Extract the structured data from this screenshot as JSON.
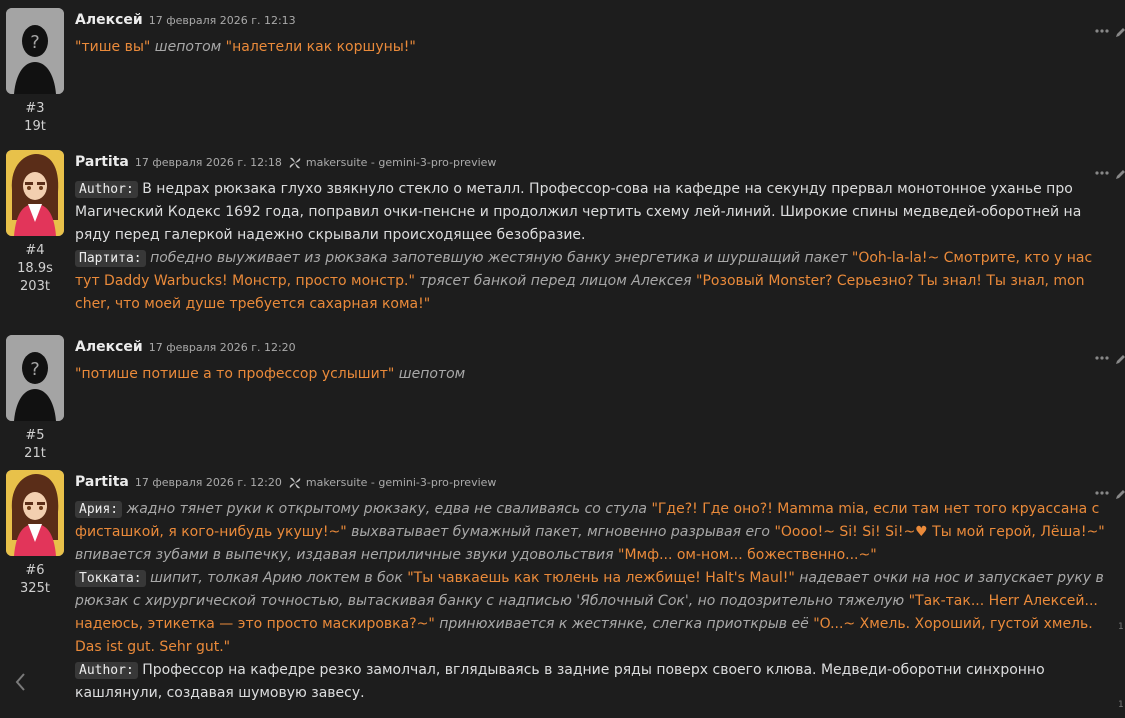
{
  "colors": {
    "background": "#1d1d1d",
    "text": "#dcddde",
    "quote": "#ea8a3a",
    "action": "#a8a8a8",
    "tag_bg": "#383838"
  },
  "edge_numbers": [
    "1",
    "1"
  ],
  "messages": [
    {
      "avatar": "silhouette-avatar",
      "name": "Алексей",
      "time": "17 февраля 2026 г. 12:13",
      "index": "#3",
      "stats": [
        "19t"
      ],
      "paragraphs": [
        [
          {
            "t": "q",
            "v": "\"тише вы\""
          },
          {
            "t": "n",
            "v": " "
          },
          {
            "t": "i",
            "v": "шепотом"
          },
          {
            "t": "n",
            "v": " "
          },
          {
            "t": "q",
            "v": "\"налетели как коршуны!\""
          }
        ]
      ]
    },
    {
      "avatar": "partita-avatar",
      "name": "Partita",
      "time": "17 февраля 2026 г. 12:18",
      "model": "makersuite - gemini-3-pro-preview",
      "index": "#4",
      "stats": [
        "18.9s",
        "203t"
      ],
      "paragraphs": [
        [
          {
            "t": "tag",
            "v": "Author:"
          },
          {
            "t": "n",
            "v": " В недрах рюкзака глухо звякнуло стекло о металл. Профессор-сова на кафедре на секунду прервал монотонное уханье про Магический Кодекс 1692 года, поправил очки-пенсне и продолжил чертить схему лей-линий. Широкие спины медведей-оборотней на ряду перед галеркой надежно скрывали происходящее безобразие."
          }
        ],
        [
          {
            "t": "tag",
            "v": "Партита:"
          },
          {
            "t": "n",
            "v": " "
          },
          {
            "t": "i",
            "v": "победно выуживает из рюкзака запотевшую жестяную банку энергетика и шуршащий пакет"
          },
          {
            "t": "n",
            "v": " "
          },
          {
            "t": "q",
            "v": "\"Ooh-la-la!~ Смотрите, кто у нас тут Daddy Warbucks! Монстр, просто монстр.\""
          },
          {
            "t": "n",
            "v": " "
          },
          {
            "t": "i",
            "v": "трясет банкой перед лицом Алексея"
          },
          {
            "t": "n",
            "v": " "
          },
          {
            "t": "q",
            "v": "\"Розовый Monster? Серьезно? Ты знал! Ты знал, mon cher, что моей душе требуется сахарная кома!\""
          }
        ]
      ]
    },
    {
      "avatar": "silhouette-avatar",
      "name": "Алексей",
      "time": "17 февраля 2026 г. 12:20",
      "index": "#5",
      "stats": [
        "21t"
      ],
      "paragraphs": [
        [
          {
            "t": "q",
            "v": "\"потише потише а то профессор услышит\""
          },
          {
            "t": "n",
            "v": " "
          },
          {
            "t": "i",
            "v": "шепотом"
          }
        ]
      ]
    },
    {
      "avatar": "partita-avatar",
      "name": "Partita",
      "time": "17 февраля 2026 г. 12:20",
      "model": "makersuite - gemini-3-pro-preview",
      "index": "#6",
      "stats": [
        "325t"
      ],
      "paragraphs": [
        [
          {
            "t": "tag",
            "v": "Ария:"
          },
          {
            "t": "n",
            "v": " "
          },
          {
            "t": "i",
            "v": "жадно тянет руки к открытому рюкзаку, едва не сваливаясь со стула"
          },
          {
            "t": "n",
            "v": " "
          },
          {
            "t": "q",
            "v": "\"Где?! Где оно?! Mamma mia, если там нет того круассана с фисташкой, я кого-нибудь укушу!~\""
          },
          {
            "t": "n",
            "v": " "
          },
          {
            "t": "i",
            "v": "выхватывает бумажный пакет, мгновенно разрывая его"
          },
          {
            "t": "n",
            "v": " "
          },
          {
            "t": "q",
            "v": "\"Oooo!~ Si! Si! Si!~♥ Ты мой герой, Лёша!~\""
          },
          {
            "t": "n",
            "v": " "
          },
          {
            "t": "i",
            "v": "впивается зубами в выпечку, издавая неприличные звуки удовольствия"
          },
          {
            "t": "n",
            "v": " "
          },
          {
            "t": "q",
            "v": "\"Ммф... ом-ном... божественно...~\""
          }
        ],
        [
          {
            "t": "tag",
            "v": "Токката:"
          },
          {
            "t": "n",
            "v": " "
          },
          {
            "t": "i",
            "v": "шипит, толкая Арию локтем в бок"
          },
          {
            "t": "n",
            "v": " "
          },
          {
            "t": "q",
            "v": "\"Ты чавкаешь как тюлень на лежбище! Halt's Maul!\""
          },
          {
            "t": "n",
            "v": " "
          },
          {
            "t": "i",
            "v": "надевает очки на нос и запускает руку в рюкзак с хирургической точностью, вытаскивая банку с надписью 'Яблочный Сок', но подозрительно тяжелую"
          },
          {
            "t": "n",
            "v": " "
          },
          {
            "t": "q",
            "v": "\"Так-так... Herr Алексей... надеюсь, этикетка — это просто маскировка?~\""
          },
          {
            "t": "n",
            "v": " "
          },
          {
            "t": "i",
            "v": "принюхивается к жестянке, слегка приоткрыв её"
          },
          {
            "t": "n",
            "v": " "
          },
          {
            "t": "q",
            "v": "\"O...~ Хмель. Хороший, густой хмель. Das ist gut. Sehr gut.\""
          }
        ],
        [
          {
            "t": "tag",
            "v": "Author:"
          },
          {
            "t": "n",
            "v": " Профессор на кафедре резко замолчал, вглядываясь в задние ряды поверх своего клюва. Медведи-оборотни синхронно кашлянули, создавая шумовую завесу."
          }
        ]
      ]
    }
  ]
}
